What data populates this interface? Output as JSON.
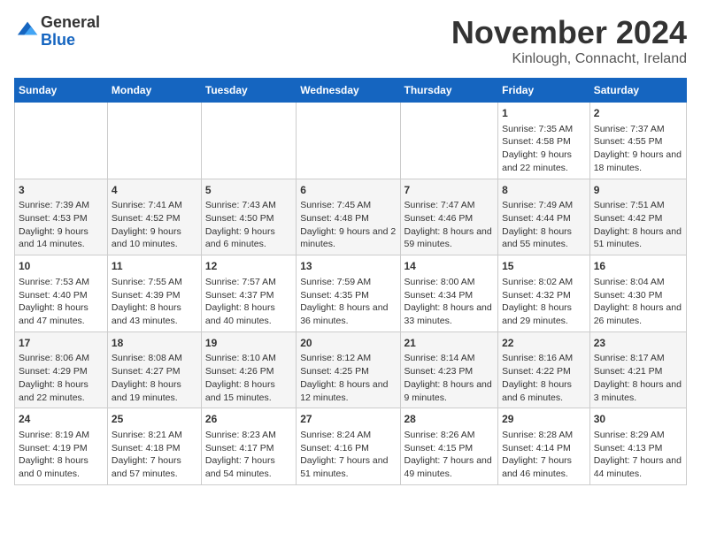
{
  "header": {
    "logo_general": "General",
    "logo_blue": "Blue",
    "title": "November 2024",
    "subtitle": "Kinlough, Connacht, Ireland"
  },
  "weekdays": [
    "Sunday",
    "Monday",
    "Tuesday",
    "Wednesday",
    "Thursday",
    "Friday",
    "Saturday"
  ],
  "weeks": [
    [
      {
        "day": "",
        "info": ""
      },
      {
        "day": "",
        "info": ""
      },
      {
        "day": "",
        "info": ""
      },
      {
        "day": "",
        "info": ""
      },
      {
        "day": "",
        "info": ""
      },
      {
        "day": "1",
        "info": "Sunrise: 7:35 AM\nSunset: 4:58 PM\nDaylight: 9 hours and 22 minutes."
      },
      {
        "day": "2",
        "info": "Sunrise: 7:37 AM\nSunset: 4:55 PM\nDaylight: 9 hours and 18 minutes."
      }
    ],
    [
      {
        "day": "3",
        "info": "Sunrise: 7:39 AM\nSunset: 4:53 PM\nDaylight: 9 hours and 14 minutes."
      },
      {
        "day": "4",
        "info": "Sunrise: 7:41 AM\nSunset: 4:52 PM\nDaylight: 9 hours and 10 minutes."
      },
      {
        "day": "5",
        "info": "Sunrise: 7:43 AM\nSunset: 4:50 PM\nDaylight: 9 hours and 6 minutes."
      },
      {
        "day": "6",
        "info": "Sunrise: 7:45 AM\nSunset: 4:48 PM\nDaylight: 9 hours and 2 minutes."
      },
      {
        "day": "7",
        "info": "Sunrise: 7:47 AM\nSunset: 4:46 PM\nDaylight: 8 hours and 59 minutes."
      },
      {
        "day": "8",
        "info": "Sunrise: 7:49 AM\nSunset: 4:44 PM\nDaylight: 8 hours and 55 minutes."
      },
      {
        "day": "9",
        "info": "Sunrise: 7:51 AM\nSunset: 4:42 PM\nDaylight: 8 hours and 51 minutes."
      }
    ],
    [
      {
        "day": "10",
        "info": "Sunrise: 7:53 AM\nSunset: 4:40 PM\nDaylight: 8 hours and 47 minutes."
      },
      {
        "day": "11",
        "info": "Sunrise: 7:55 AM\nSunset: 4:39 PM\nDaylight: 8 hours and 43 minutes."
      },
      {
        "day": "12",
        "info": "Sunrise: 7:57 AM\nSunset: 4:37 PM\nDaylight: 8 hours and 40 minutes."
      },
      {
        "day": "13",
        "info": "Sunrise: 7:59 AM\nSunset: 4:35 PM\nDaylight: 8 hours and 36 minutes."
      },
      {
        "day": "14",
        "info": "Sunrise: 8:00 AM\nSunset: 4:34 PM\nDaylight: 8 hours and 33 minutes."
      },
      {
        "day": "15",
        "info": "Sunrise: 8:02 AM\nSunset: 4:32 PM\nDaylight: 8 hours and 29 minutes."
      },
      {
        "day": "16",
        "info": "Sunrise: 8:04 AM\nSunset: 4:30 PM\nDaylight: 8 hours and 26 minutes."
      }
    ],
    [
      {
        "day": "17",
        "info": "Sunrise: 8:06 AM\nSunset: 4:29 PM\nDaylight: 8 hours and 22 minutes."
      },
      {
        "day": "18",
        "info": "Sunrise: 8:08 AM\nSunset: 4:27 PM\nDaylight: 8 hours and 19 minutes."
      },
      {
        "day": "19",
        "info": "Sunrise: 8:10 AM\nSunset: 4:26 PM\nDaylight: 8 hours and 15 minutes."
      },
      {
        "day": "20",
        "info": "Sunrise: 8:12 AM\nSunset: 4:25 PM\nDaylight: 8 hours and 12 minutes."
      },
      {
        "day": "21",
        "info": "Sunrise: 8:14 AM\nSunset: 4:23 PM\nDaylight: 8 hours and 9 minutes."
      },
      {
        "day": "22",
        "info": "Sunrise: 8:16 AM\nSunset: 4:22 PM\nDaylight: 8 hours and 6 minutes."
      },
      {
        "day": "23",
        "info": "Sunrise: 8:17 AM\nSunset: 4:21 PM\nDaylight: 8 hours and 3 minutes."
      }
    ],
    [
      {
        "day": "24",
        "info": "Sunrise: 8:19 AM\nSunset: 4:19 PM\nDaylight: 8 hours and 0 minutes."
      },
      {
        "day": "25",
        "info": "Sunrise: 8:21 AM\nSunset: 4:18 PM\nDaylight: 7 hours and 57 minutes."
      },
      {
        "day": "26",
        "info": "Sunrise: 8:23 AM\nSunset: 4:17 PM\nDaylight: 7 hours and 54 minutes."
      },
      {
        "day": "27",
        "info": "Sunrise: 8:24 AM\nSunset: 4:16 PM\nDaylight: 7 hours and 51 minutes."
      },
      {
        "day": "28",
        "info": "Sunrise: 8:26 AM\nSunset: 4:15 PM\nDaylight: 7 hours and 49 minutes."
      },
      {
        "day": "29",
        "info": "Sunrise: 8:28 AM\nSunset: 4:14 PM\nDaylight: 7 hours and 46 minutes."
      },
      {
        "day": "30",
        "info": "Sunrise: 8:29 AM\nSunset: 4:13 PM\nDaylight: 7 hours and 44 minutes."
      }
    ]
  ]
}
